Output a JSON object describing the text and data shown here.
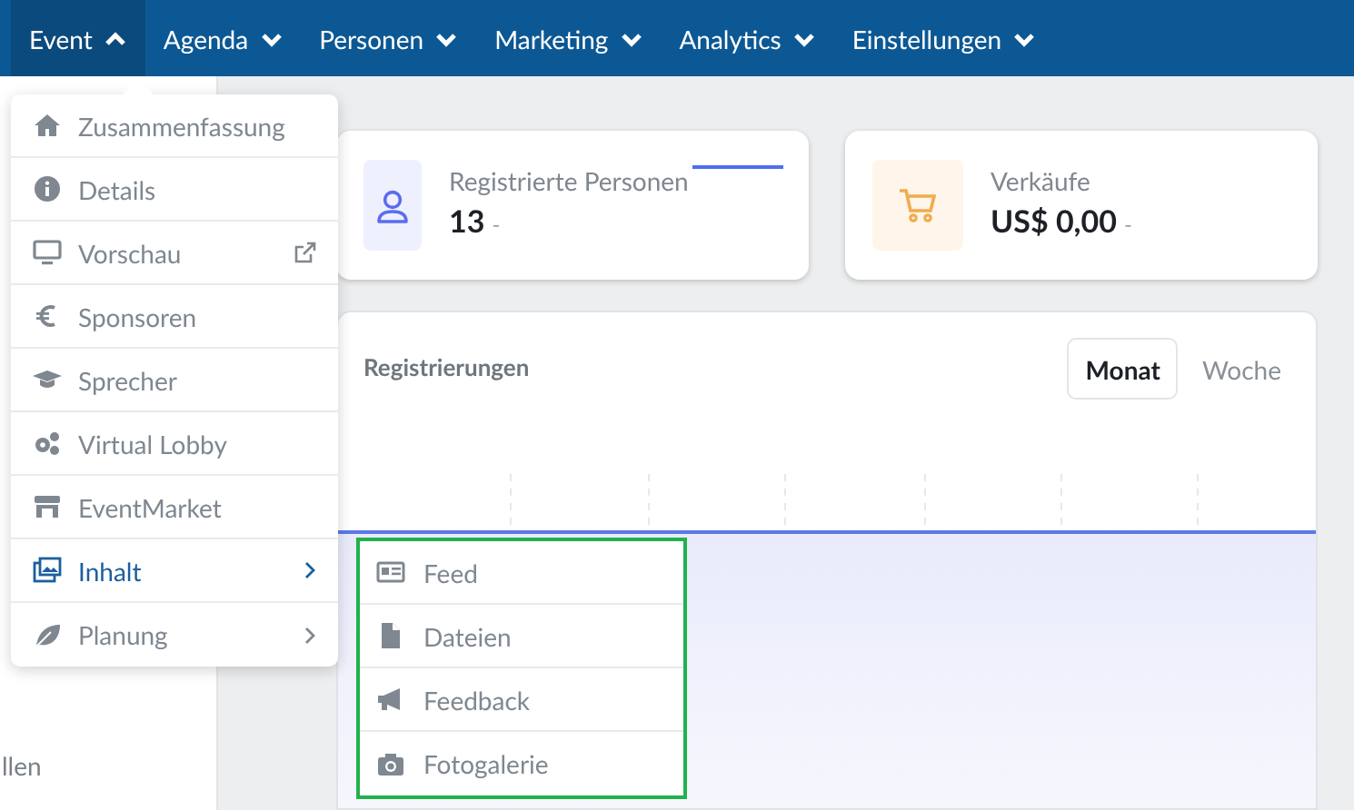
{
  "nav": [
    {
      "label": "Event",
      "selected": true
    },
    {
      "label": "Agenda",
      "selected": false
    },
    {
      "label": "Personen",
      "selected": false
    },
    {
      "label": "Marketing",
      "selected": false
    },
    {
      "label": "Analytics",
      "selected": false
    },
    {
      "label": "Einstellungen",
      "selected": false
    }
  ],
  "sidebar_fragment": "llen",
  "event_menu": [
    {
      "label": "Zusammenfassung",
      "selected": false
    },
    {
      "label": "Details",
      "selected": false
    },
    {
      "label": "Vorschau",
      "external": true,
      "selected": false
    },
    {
      "label": "Sponsoren",
      "selected": false
    },
    {
      "label": "Sprecher",
      "selected": false
    },
    {
      "label": "Virtual Lobby",
      "selected": false
    },
    {
      "label": "EventMarket",
      "selected": false
    },
    {
      "label": "Inhalt",
      "submenu": true,
      "selected": true
    },
    {
      "label": "Planung",
      "submenu": true,
      "selected": false
    }
  ],
  "submenu": [
    {
      "label": "Feed"
    },
    {
      "label": "Dateien"
    },
    {
      "label": "Feedback"
    },
    {
      "label": "Fotogalerie"
    }
  ],
  "stats": [
    {
      "label": "Registrierte Personen",
      "value": "13",
      "change": "-"
    },
    {
      "label": "Verkäufe",
      "value": "US$ 0,00",
      "change": "-"
    }
  ],
  "chart": {
    "title": "Registrierungen",
    "tabs": [
      {
        "label": "Monat",
        "selected": true
      },
      {
        "label": "Woche",
        "selected": false
      }
    ]
  }
}
